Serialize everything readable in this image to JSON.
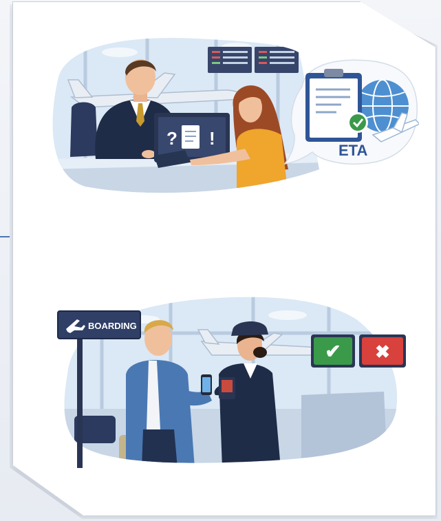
{
  "top_scene": {
    "document_label": "ETA",
    "screen_glyph_left": "?",
    "screen_glyph_right": "!"
  },
  "bottom_scene": {
    "sign_label": "BOARDING",
    "approve_glyph": "✔",
    "reject_glyph": "✖"
  },
  "colors": {
    "accent_blue": "#2f5597",
    "sky": "#d6e6f5",
    "approve_green": "#3a9a4a",
    "reject_red": "#d8413c",
    "navy_suit": "#1f2c47"
  }
}
